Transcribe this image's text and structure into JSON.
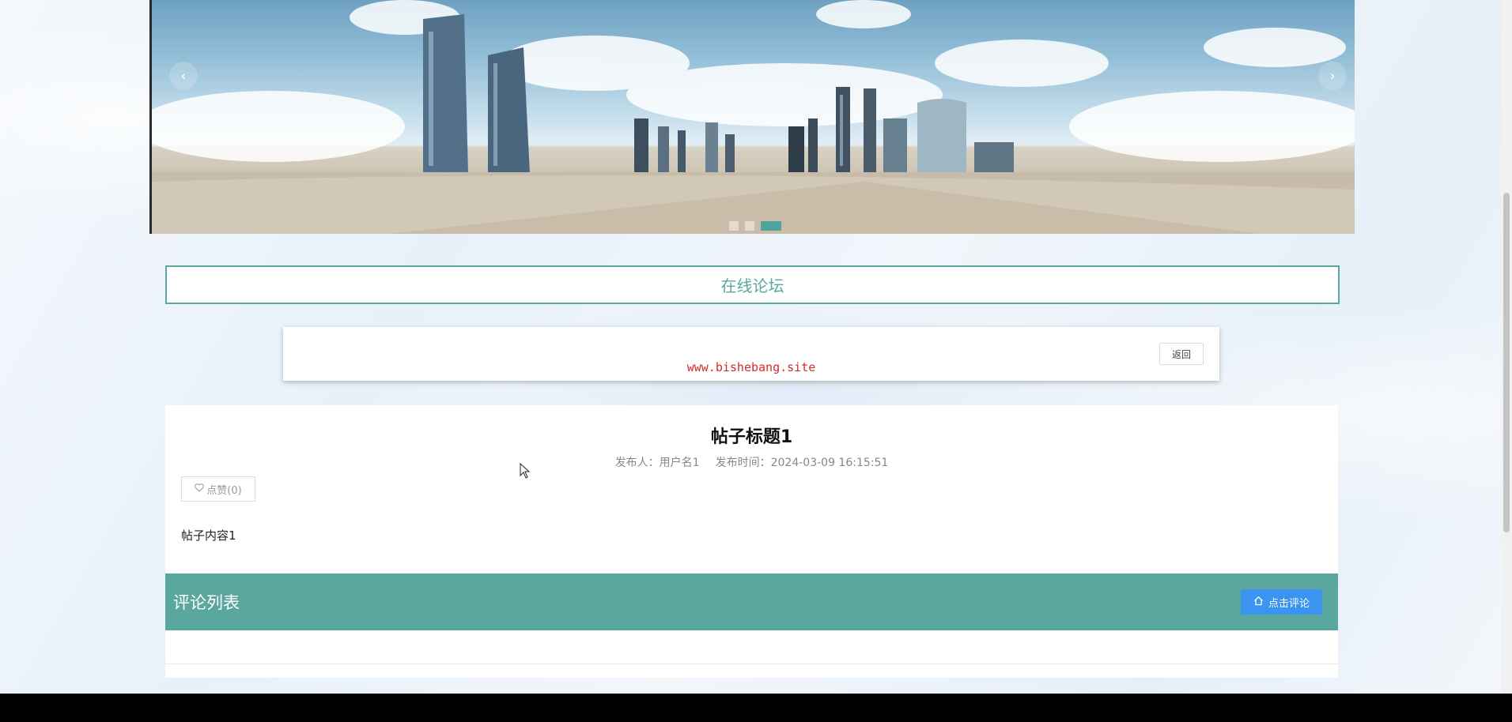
{
  "carousel": {
    "prev_label": "‹",
    "next_label": "›",
    "dots": 3,
    "active_dot": 3,
    "accent_color": "#4fa59b"
  },
  "section": {
    "title": "在线论坛"
  },
  "top_panel": {
    "watermark": "www.bishebang.site",
    "back_label": "返回"
  },
  "post": {
    "title": "帖子标题1",
    "author_label": "发布人：用户名1",
    "time_label": "发布时间：2024-03-09 16:15:51",
    "like_label": "点赞(0)",
    "like_icon": "heart-outline-icon",
    "content": "帖子内容1"
  },
  "comments": {
    "title": "评论列表",
    "comment_button_label": "点击评论",
    "comment_button_icon": "home-icon",
    "header_color": "#5aa7a0",
    "button_color": "#3a94f0"
  }
}
